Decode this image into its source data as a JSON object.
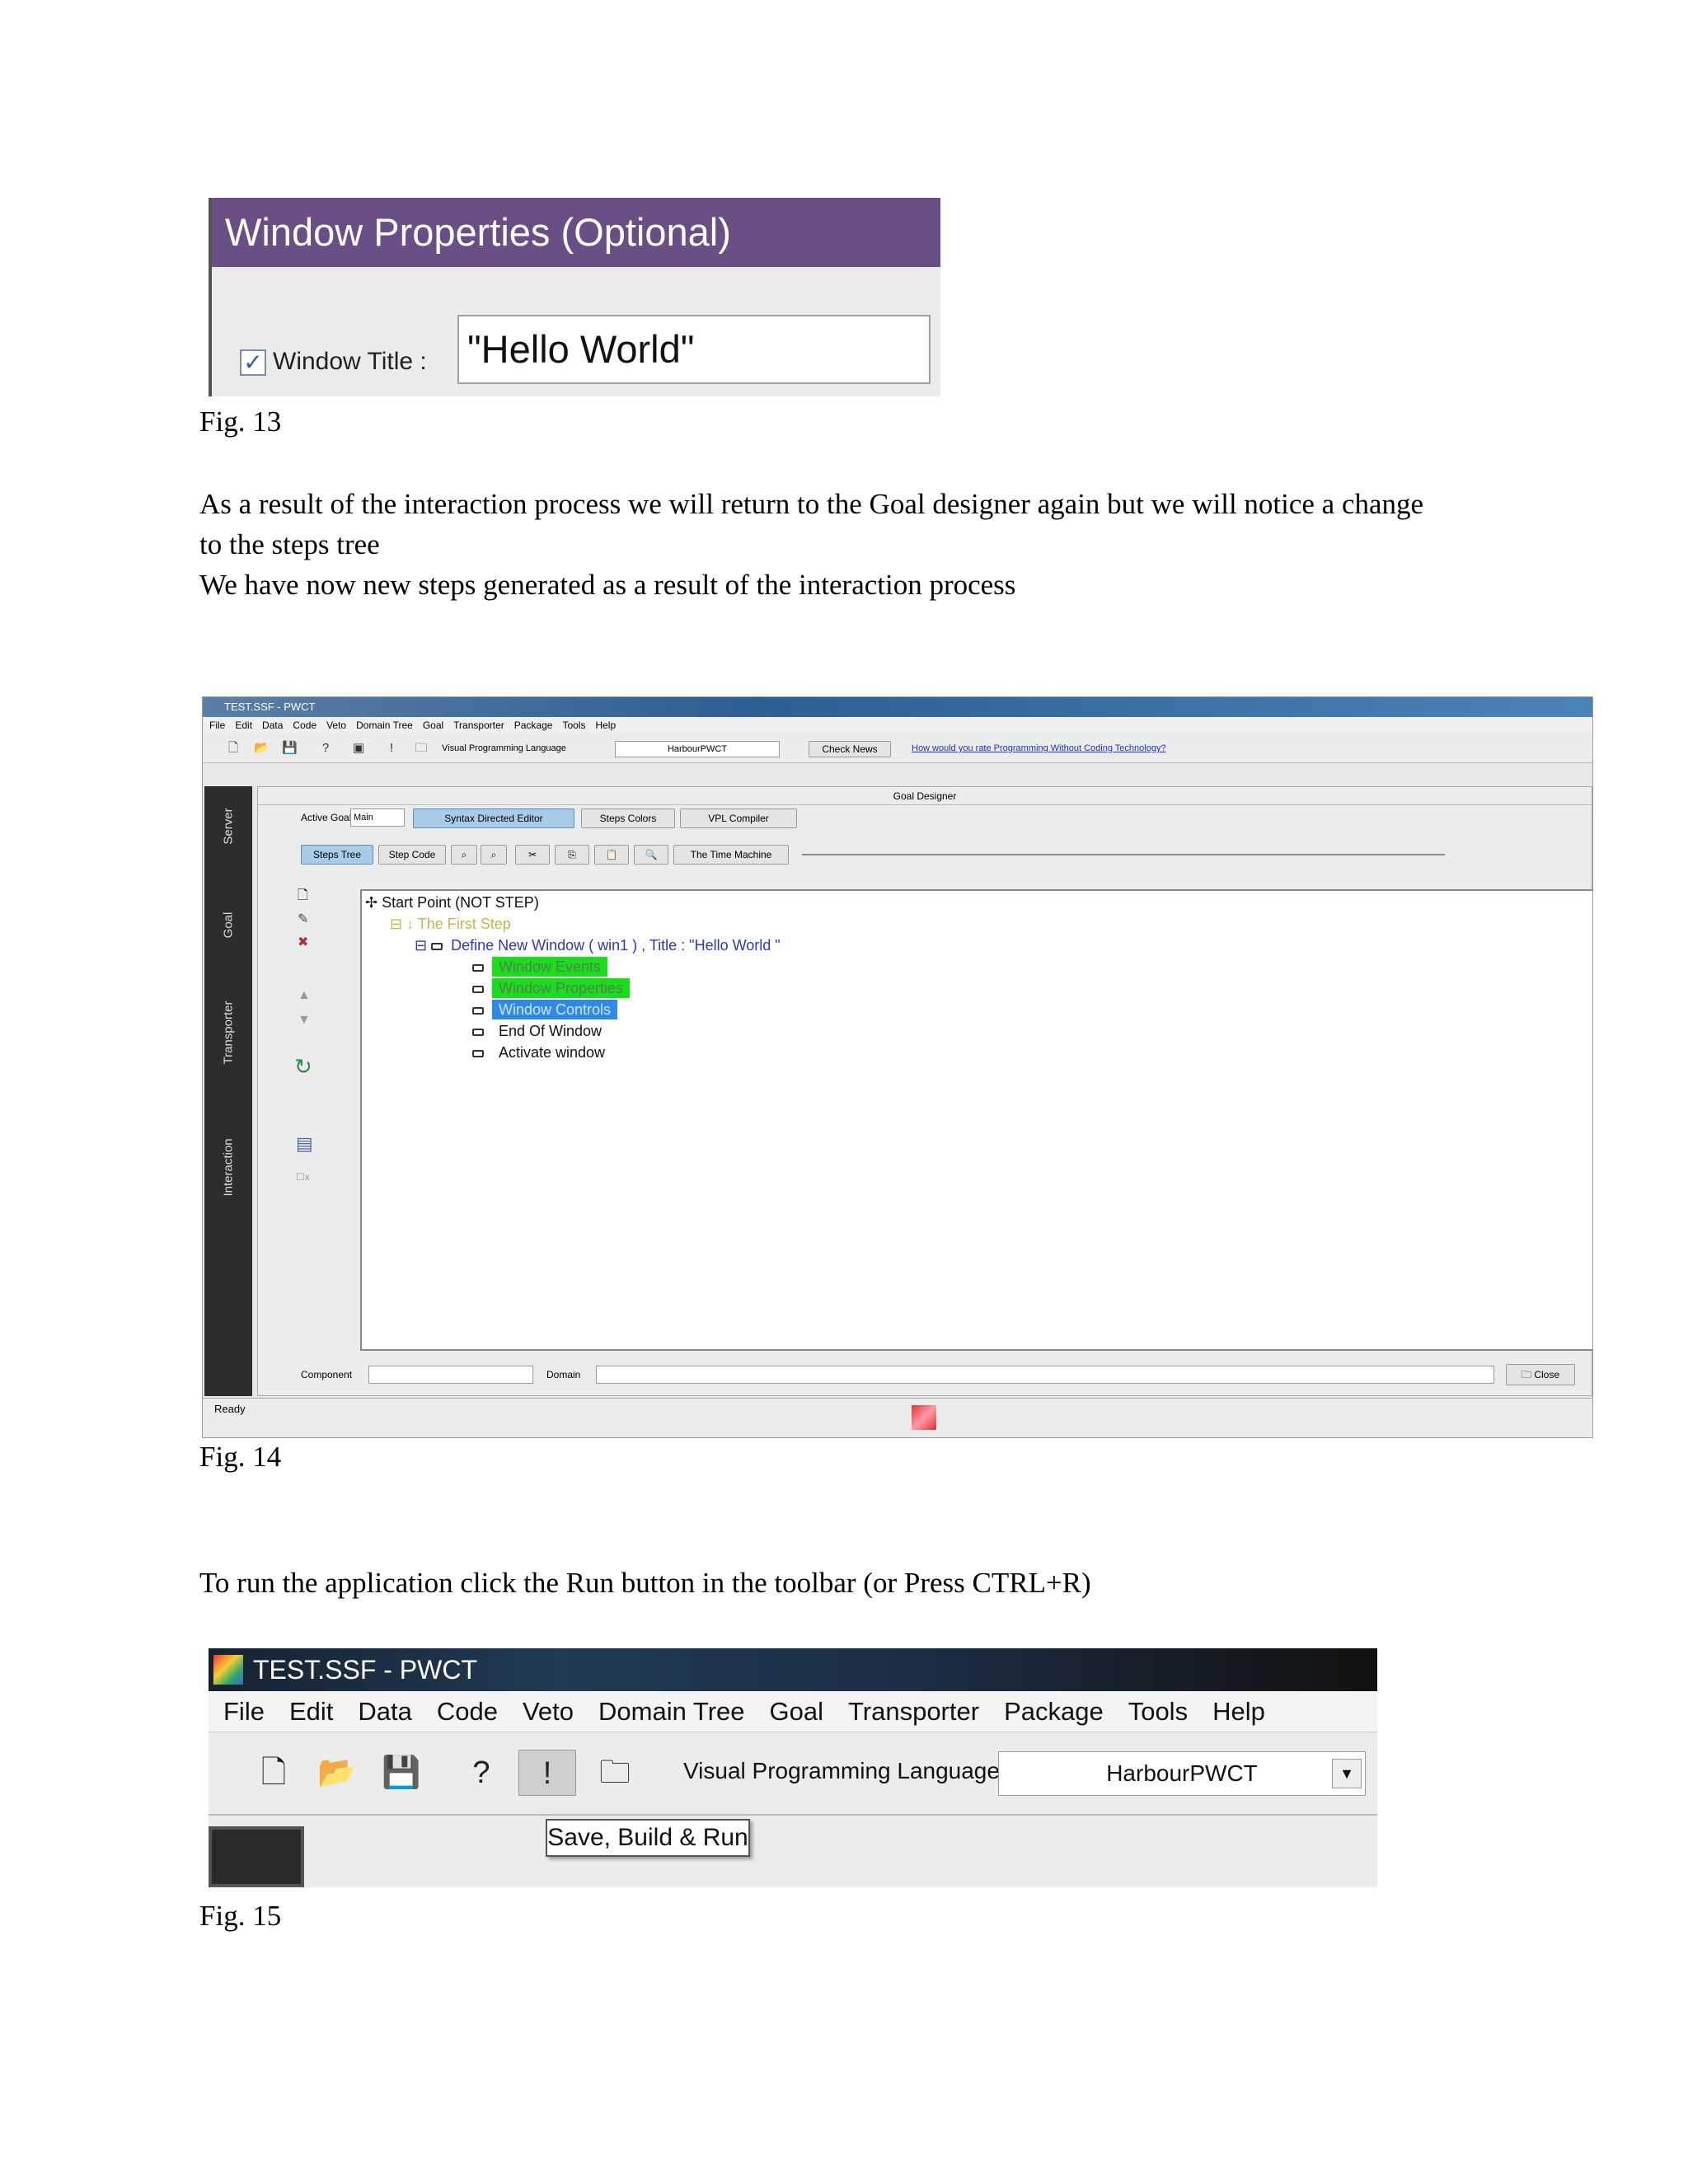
{
  "fig13": {
    "header": "Window Properties (Optional)",
    "checkbox_label": "Window Title :",
    "checkbox_mark": "✓",
    "title_value": "\"Hello World\"",
    "caption": "Fig. 13"
  },
  "text": {
    "para1_line1": "As a result of the interaction process we will return to the Goal designer again but we will notice a change",
    "para1_line2": "to the steps tree",
    "para2": "We have now new steps generated as a result of the interaction process",
    "para3": "To run the application click the Run button in the toolbar (or Press CTRL+R)"
  },
  "fig14": {
    "window_title": "TEST.SSF - PWCT",
    "menu": [
      "File",
      "Edit",
      "Data",
      "Code",
      "Veto",
      "Domain Tree",
      "Goal",
      "Transporter",
      "Package",
      "Tools",
      "Help"
    ],
    "vpl_label": "Visual Programming Language",
    "vpl_value": "HarbourPWCT",
    "check_news": "Check News",
    "rate_link": "How would you rate Programming Without Coding Technology?",
    "panel_title": "Goal Designer",
    "active_goal_label": "Active Goal :",
    "active_goal_value": "Main",
    "syntax_editor": "Syntax Directed Editor",
    "steps_colors": "Steps Colors",
    "vpl_compiler": "VPL Compiler",
    "steps_tree": "Steps Tree",
    "step_code": "Step Code",
    "time_machine": "The Time Machine",
    "side_tabs": [
      "Server",
      "Goal",
      "Transporter",
      "Interaction"
    ],
    "tree": {
      "start": "Start Point (NOT STEP)",
      "first": "The First Step",
      "define": "Define New Window  ( win1 ) , Title : \"Hello World  \"",
      "events": "Window Events",
      "props": "Window Properties",
      "controls": "Window Controls",
      "end": "End Of Window",
      "activate": "Activate window"
    },
    "component_label": "Component",
    "domain_label": "Domain",
    "close": "Close",
    "status": "Ready",
    "caption": "Fig. 14"
  },
  "fig15": {
    "window_title": "TEST.SSF  - PWCT",
    "menu": [
      "File",
      "Edit",
      "Data",
      "Code",
      "Veto",
      "Domain Tree",
      "Goal",
      "Transporter",
      "Package",
      "Tools",
      "Help"
    ],
    "vpl_label": "Visual Programming Language",
    "vpl_value": "HarbourPWCT",
    "tooltip": "Save, Build & Run",
    "caption": "Fig. 15"
  }
}
